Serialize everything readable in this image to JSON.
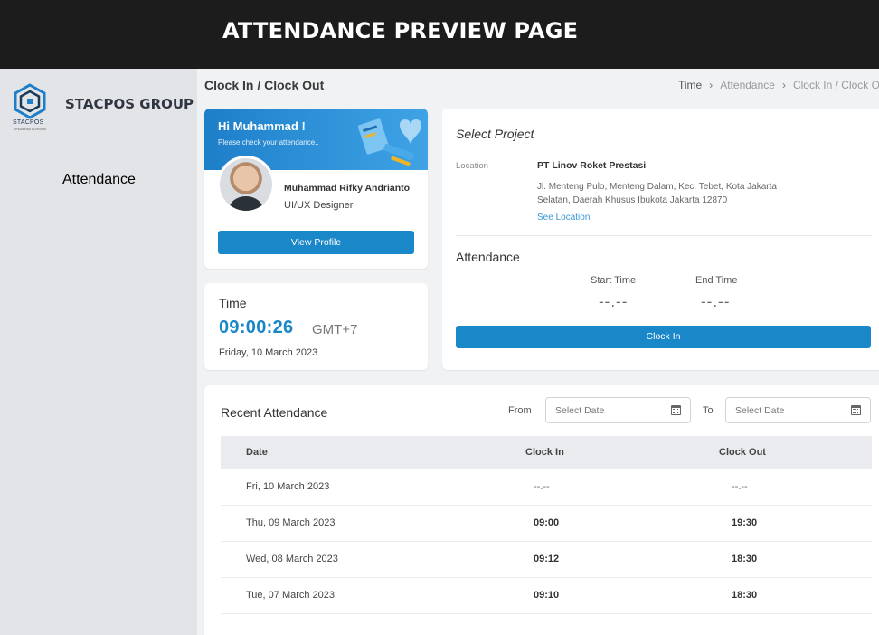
{
  "banner": {
    "title": "ATTENDANCE PREVIEW PAGE"
  },
  "sidebar": {
    "logo_text": "STACPOS",
    "logo_tagline": "INTEGRATED PLATFORM",
    "brand": "STACPOS GROUP",
    "items": [
      {
        "label": "Attendance"
      }
    ]
  },
  "header": {
    "title": "Clock In / Clock Out",
    "breadcrumb": [
      "Time",
      "Attendance",
      "Clock In / Clock Out"
    ]
  },
  "profile": {
    "greeting": "Hi Muhammad !",
    "subtitle": "Please check your attendance..",
    "name": "Muhammad Rifky Andrianto",
    "role": "UI/UX Designer",
    "button": "View Profile"
  },
  "time": {
    "label": "Time",
    "clock": "09:00:26",
    "timezone": "GMT+7",
    "date": "Friday, 10 March 2023"
  },
  "project": {
    "title": "Select Project",
    "location_label": "Location",
    "location_name": "PT Linov Roket Prestasi",
    "address": "Jl. Menteng Pulo, Menteng Dalam, Kec. Tebet, Kota Jakarta Selatan, Daerah Khusus Ibukota Jakarta 12870",
    "see_location": "See Location",
    "attendance_title": "Attendance",
    "start_label": "Start Time",
    "end_label": "End Time",
    "start_value": "--.--",
    "end_value": "--.--",
    "clock_in_button": "Clock In"
  },
  "recent": {
    "title": "Recent Attendance",
    "from_label": "From",
    "to_label": "To",
    "from_placeholder": "Select Date",
    "to_placeholder": "Select Date",
    "columns": [
      "Date",
      "Clock In",
      "Clock Out"
    ],
    "rows": [
      {
        "date": "Fri, 10 March 2023",
        "clock_in": "--.--",
        "clock_out": "--.--"
      },
      {
        "date": "Thu, 09 March 2023",
        "clock_in": "09:00",
        "clock_out": "19:30"
      },
      {
        "date": "Wed, 08 March 2023",
        "clock_in": "09:12",
        "clock_out": "18:30"
      },
      {
        "date": "Tue, 07 March 2023",
        "clock_in": "09:10",
        "clock_out": "18:30"
      }
    ]
  },
  "colors": {
    "accent": "#1a87c9",
    "banner": "#1c1c1c",
    "sidebar": "#e3e4e8"
  }
}
